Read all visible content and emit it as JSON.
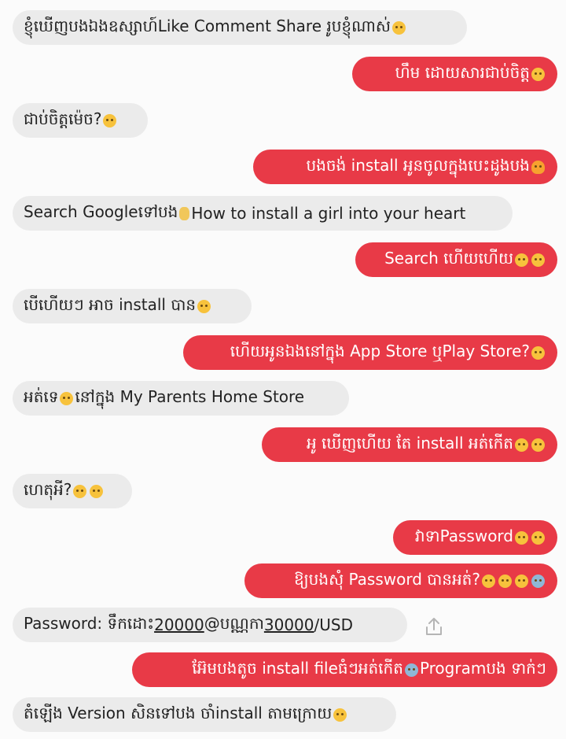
{
  "messages": [
    {
      "side": "in",
      "parts": [
        {
          "t": "ខ្ញុំឃើញបងឯងឧស្សាហ៍Like Comment Share រូបខ្ញុំណាស់"
        },
        {
          "e": "smile"
        }
      ]
    },
    {
      "side": "out",
      "parts": [
        {
          "t": "ហឹម ដោយសារជាប់ចិត្ត"
        },
        {
          "e": "grin"
        }
      ]
    },
    {
      "side": "in",
      "parts": [
        {
          "t": "ជាប់ចិត្តម៉េច?"
        },
        {
          "e": "surprised"
        }
      ]
    },
    {
      "side": "out",
      "parts": [
        {
          "t": "បងចង់ install អូនចូលក្នុងបេះដូងបង"
        },
        {
          "e": "fire"
        }
      ]
    },
    {
      "side": "in",
      "parts": [
        {
          "t": "Search Googleទៅបង"
        },
        {
          "e": "hand"
        },
        {
          "t": " How to install a girl into your heart"
        }
      ]
    },
    {
      "side": "out",
      "parts": [
        {
          "t": "Search ហើយហើយ"
        },
        {
          "e": "unamused"
        },
        {
          "e": "unamused"
        }
      ]
    },
    {
      "side": "in",
      "parts": [
        {
          "t": "បើហើយៗ អាច install បាន"
        },
        {
          "e": "grin"
        }
      ]
    },
    {
      "side": "out",
      "parts": [
        {
          "t": "ហើយអូនឯងនៅក្នុង App Store ឬPlay Store?"
        },
        {
          "e": "grin"
        }
      ]
    },
    {
      "side": "in",
      "parts": [
        {
          "t": "អត់ទេ"
        },
        {
          "e": "unamused"
        },
        {
          "t": " នៅក្នុង My Parents Home Store"
        }
      ]
    },
    {
      "side": "out",
      "parts": [
        {
          "t": "អូ ឃើញហើយ តែ install អត់កើត"
        },
        {
          "e": "unamused"
        },
        {
          "e": "unamused"
        }
      ]
    },
    {
      "side": "in",
      "parts": [
        {
          "t": "ហេតុអី?"
        },
        {
          "e": "neutral"
        },
        {
          "e": "surprised"
        }
      ]
    },
    {
      "side": "out",
      "parts": [
        {
          "t": "វាទាPassword"
        },
        {
          "e": "grin"
        },
        {
          "e": "sad"
        }
      ]
    },
    {
      "side": "out",
      "parts": [
        {
          "t": "ឱ្យបងសុំ Password បានអត់?"
        },
        {
          "e": "sad"
        },
        {
          "e": "sad"
        },
        {
          "e": "sad"
        },
        {
          "e": "fear"
        }
      ]
    },
    {
      "side": "in",
      "parts": [
        {
          "t": "Password: ទឹកដោះ"
        },
        {
          "t": "20000",
          "u": true
        },
        {
          "t": "@បណ្ណកា"
        },
        {
          "t": "30000",
          "u": true
        },
        {
          "t": "/USD"
        }
      ]
    },
    {
      "side": "out",
      "parts": [
        {
          "t": "អ៊ែមបងតូច install fileធំៗអត់កើត"
        },
        {
          "e": "cry"
        },
        {
          "t": " Programបង ទាក់ៗ"
        }
      ]
    },
    {
      "side": "in",
      "parts": [
        {
          "t": "តំឡើង Version សិនទៅបង ចាំinstall តាមក្រោយ"
        },
        {
          "e": "grin"
        }
      ]
    }
  ],
  "share_icon": "share-upload-icon"
}
